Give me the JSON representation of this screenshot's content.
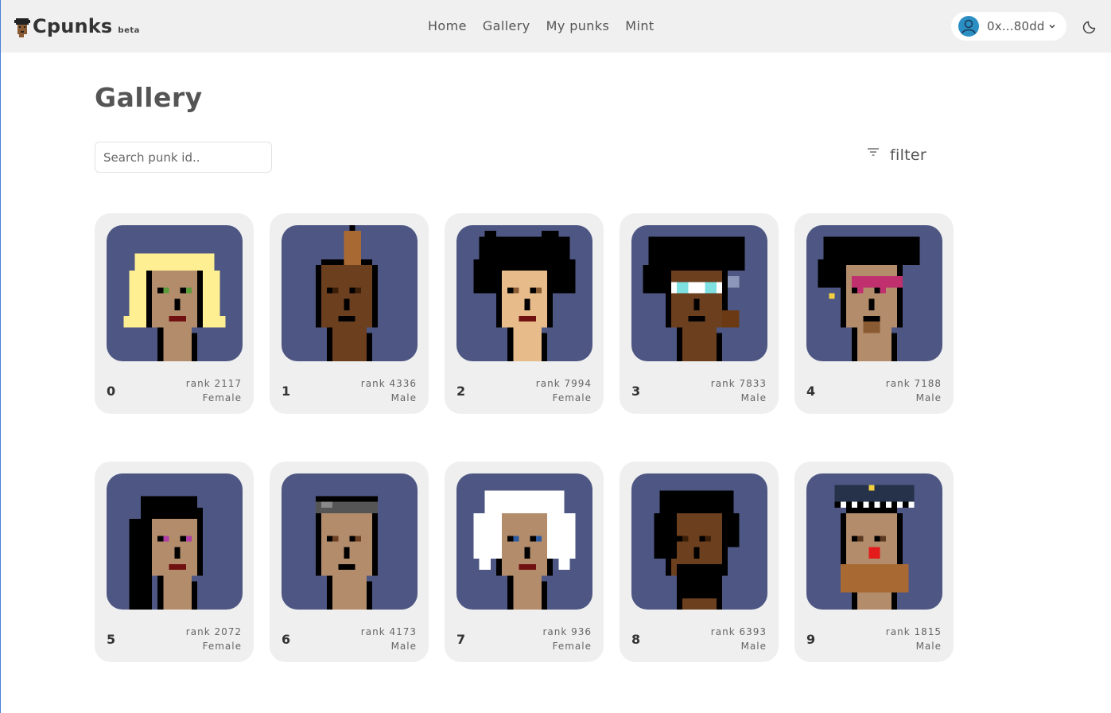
{
  "app": {
    "logo_text": "Cpunks",
    "logo_badge": "beta"
  },
  "nav": {
    "items": [
      {
        "label": "Home"
      },
      {
        "label": "Gallery"
      },
      {
        "label": "My punks"
      },
      {
        "label": "Mint"
      }
    ]
  },
  "wallet": {
    "address": "0x...80dd",
    "icons": [
      "user-avatar-icon",
      "chevron-down-icon"
    ]
  },
  "theme_toggle": {
    "icon": "moon-icon"
  },
  "page": {
    "title": "Gallery",
    "search_placeholder": "Search punk id..",
    "filter_label": "filter",
    "filter_icon": "filter-icon"
  },
  "colors": {
    "card_bg": "#efefef",
    "punk_bg": "#4e5783",
    "header_bg": "#f0f0f0",
    "wallet_avatar": "#2b8fc4"
  },
  "punks": [
    {
      "id": "0",
      "rank": "rank 2117",
      "gender": "Female",
      "skin": "#b28c6b",
      "hair": "#ffef93",
      "eyes": "#5b9b3a"
    },
    {
      "id": "1",
      "rank": "rank 4336",
      "gender": "Male",
      "skin": "#6c3f1e",
      "hair": "#a86a32",
      "eyes": "#3b1e08"
    },
    {
      "id": "2",
      "rank": "rank 7994",
      "gender": "Female",
      "skin": "#e8bc8a",
      "hair": "#000000",
      "eyes": "#8a5c34"
    },
    {
      "id": "3",
      "rank": "rank 7833",
      "gender": "Male",
      "skin": "#6c3f1e",
      "hair": "#000000",
      "eyes": "#7ee0e0"
    },
    {
      "id": "4",
      "rank": "rank 7188",
      "gender": "Male",
      "skin": "#b28c6b",
      "hair": "#000000",
      "eyes": "#c0306e"
    },
    {
      "id": "5",
      "rank": "rank 2072",
      "gender": "Female",
      "skin": "#b28c6b",
      "hair": "#000000",
      "eyes": "#b03ea5"
    },
    {
      "id": "6",
      "rank": "rank 4173",
      "gender": "Male",
      "skin": "#b28c6b",
      "hair": "#555555",
      "eyes": "#6b4023"
    },
    {
      "id": "7",
      "rank": "rank 936",
      "gender": "Female",
      "skin": "#b28c6b",
      "hair": "#ffffff",
      "eyes": "#2d5ba0"
    },
    {
      "id": "8",
      "rank": "rank 6393",
      "gender": "Male",
      "skin": "#6c3f1e",
      "hair": "#000000",
      "eyes": "#3b1e08"
    },
    {
      "id": "9",
      "rank": "rank 1815",
      "gender": "Male",
      "skin": "#b28c6b",
      "hair": "#26314a",
      "eyes": "#5c3a22"
    }
  ]
}
